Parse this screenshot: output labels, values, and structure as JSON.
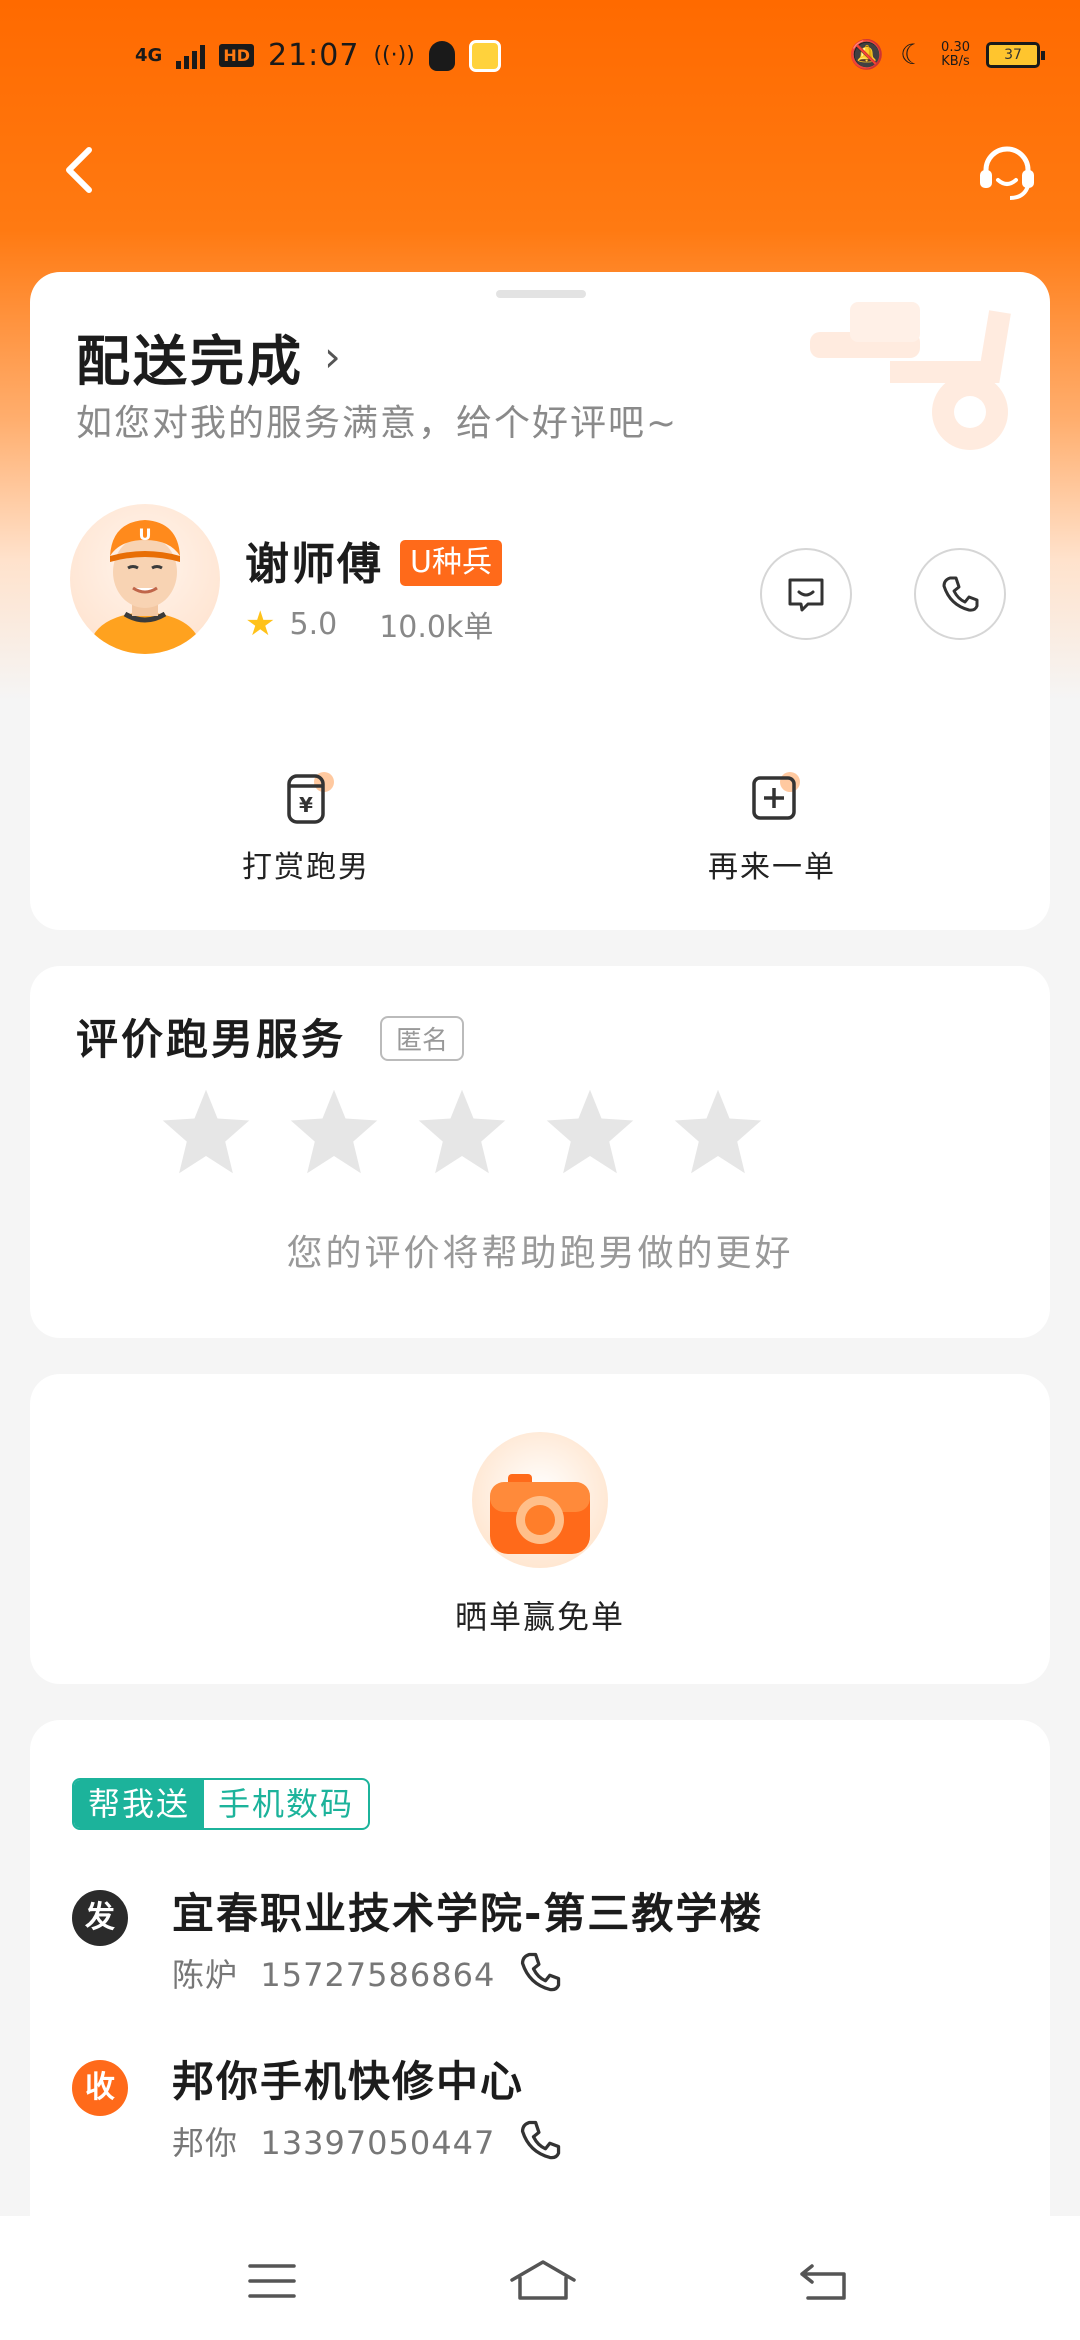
{
  "status_bar": {
    "network": "4G",
    "hd": "HD",
    "time": "21:07",
    "speed": "0.30",
    "speed_unit": "KB/s",
    "battery": "37"
  },
  "colors": {
    "accent": "#ff6a00",
    "badge": "#ff6a1a",
    "teal": "#1cb39b",
    "star_empty": "#e6e6e6",
    "star_rating": "#ffc21a"
  },
  "header": {
    "status_title": "配送完成",
    "status_subtitle": "如您对我的服务满意，给个好评吧~"
  },
  "rider": {
    "name": "谢师傅",
    "badge": "U种兵",
    "rating": "5.0",
    "orders": "10.0k单"
  },
  "actions": {
    "tip_label": "打赏跑男",
    "reorder_label": "再来一单"
  },
  "review": {
    "title": "评价跑男服务",
    "anonymous_label": "匿名",
    "star_count": 5,
    "selected_stars": 0,
    "hint": "您的评价将帮助跑男做的更好"
  },
  "share": {
    "label": "晒单赢免单"
  },
  "order": {
    "type_tag": "帮我送",
    "category_tag": "手机数码",
    "sender": {
      "badge": "发",
      "address": "宜春职业技术学院-第三教学楼",
      "name": "陈炉",
      "phone": "15727586864"
    },
    "receiver": {
      "badge": "收",
      "address": "邦你手机快修中心",
      "name": "邦你",
      "phone": "13397050447"
    }
  },
  "icons": [
    "back-icon",
    "headset-icon",
    "chevron-right-icon",
    "star-icon",
    "message-icon",
    "phone-icon",
    "tip-icon",
    "plus-icon",
    "camera-icon",
    "menu-icon",
    "home-icon",
    "return-icon"
  ]
}
